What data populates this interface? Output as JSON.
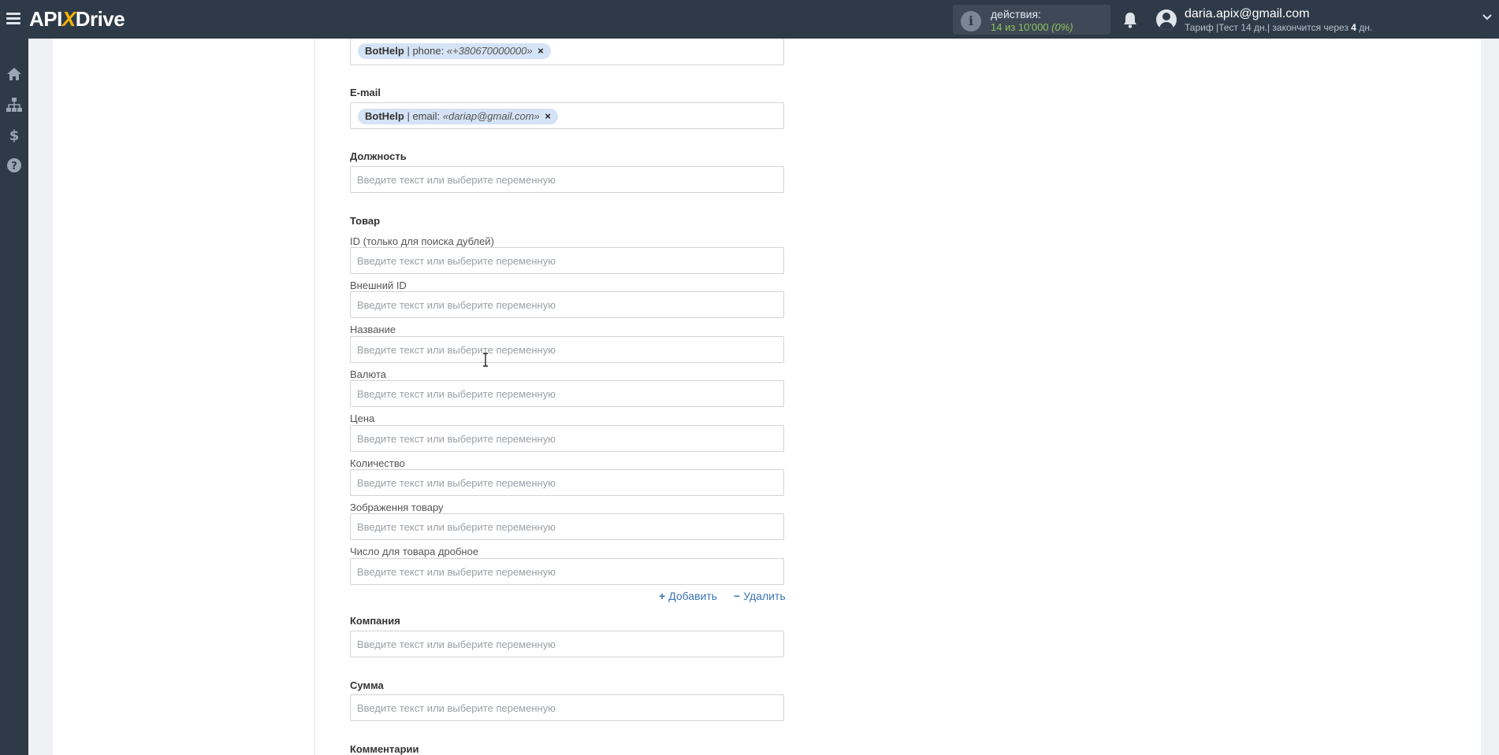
{
  "header": {
    "logo_left": "API",
    "logo_x": "X",
    "logo_right": "Drive",
    "actions_label": "действия:",
    "actions_count": "14 из 10'000",
    "actions_percent": "(0%)",
    "user_email": "daria.apix@gmail.com",
    "plan_prefix": "Тариф |Тест 14 дн.| закончится через",
    "plan_days": "4",
    "plan_suffix": "дн."
  },
  "sidebar": {
    "items": [
      {
        "icon": "home-icon"
      },
      {
        "icon": "sitemap-icon"
      },
      {
        "icon": "dollar-icon"
      },
      {
        "icon": "help-icon"
      }
    ]
  },
  "form": {
    "placeholder": "Введите текст или выберите переменную",
    "phone_tag": {
      "source": "BotHelp",
      "sep": " | phone: ",
      "value": "«+380670000000»",
      "close": "×"
    },
    "email_label": "E-mail",
    "email_tag": {
      "source": "BotHelp",
      "sep": " | email: ",
      "value": "«dariap@gmail.com»",
      "close": "×"
    },
    "position_label": "Должность",
    "product_label": "Товар",
    "product_fields": {
      "id": "ID (только для поиска дублей)",
      "external_id": "Внешний ID",
      "name": "Название",
      "currency": "Валюта",
      "price": "Цена",
      "quantity": "Количество",
      "image": "Зображення товару",
      "fraction": "Число для товара дробное"
    },
    "add_label": "Добавить",
    "add_symbol": "+",
    "remove_label": "Удалить",
    "remove_symbol": "−",
    "company_label": "Компания",
    "sum_label": "Сумма",
    "comments_label": "Комментарии"
  }
}
